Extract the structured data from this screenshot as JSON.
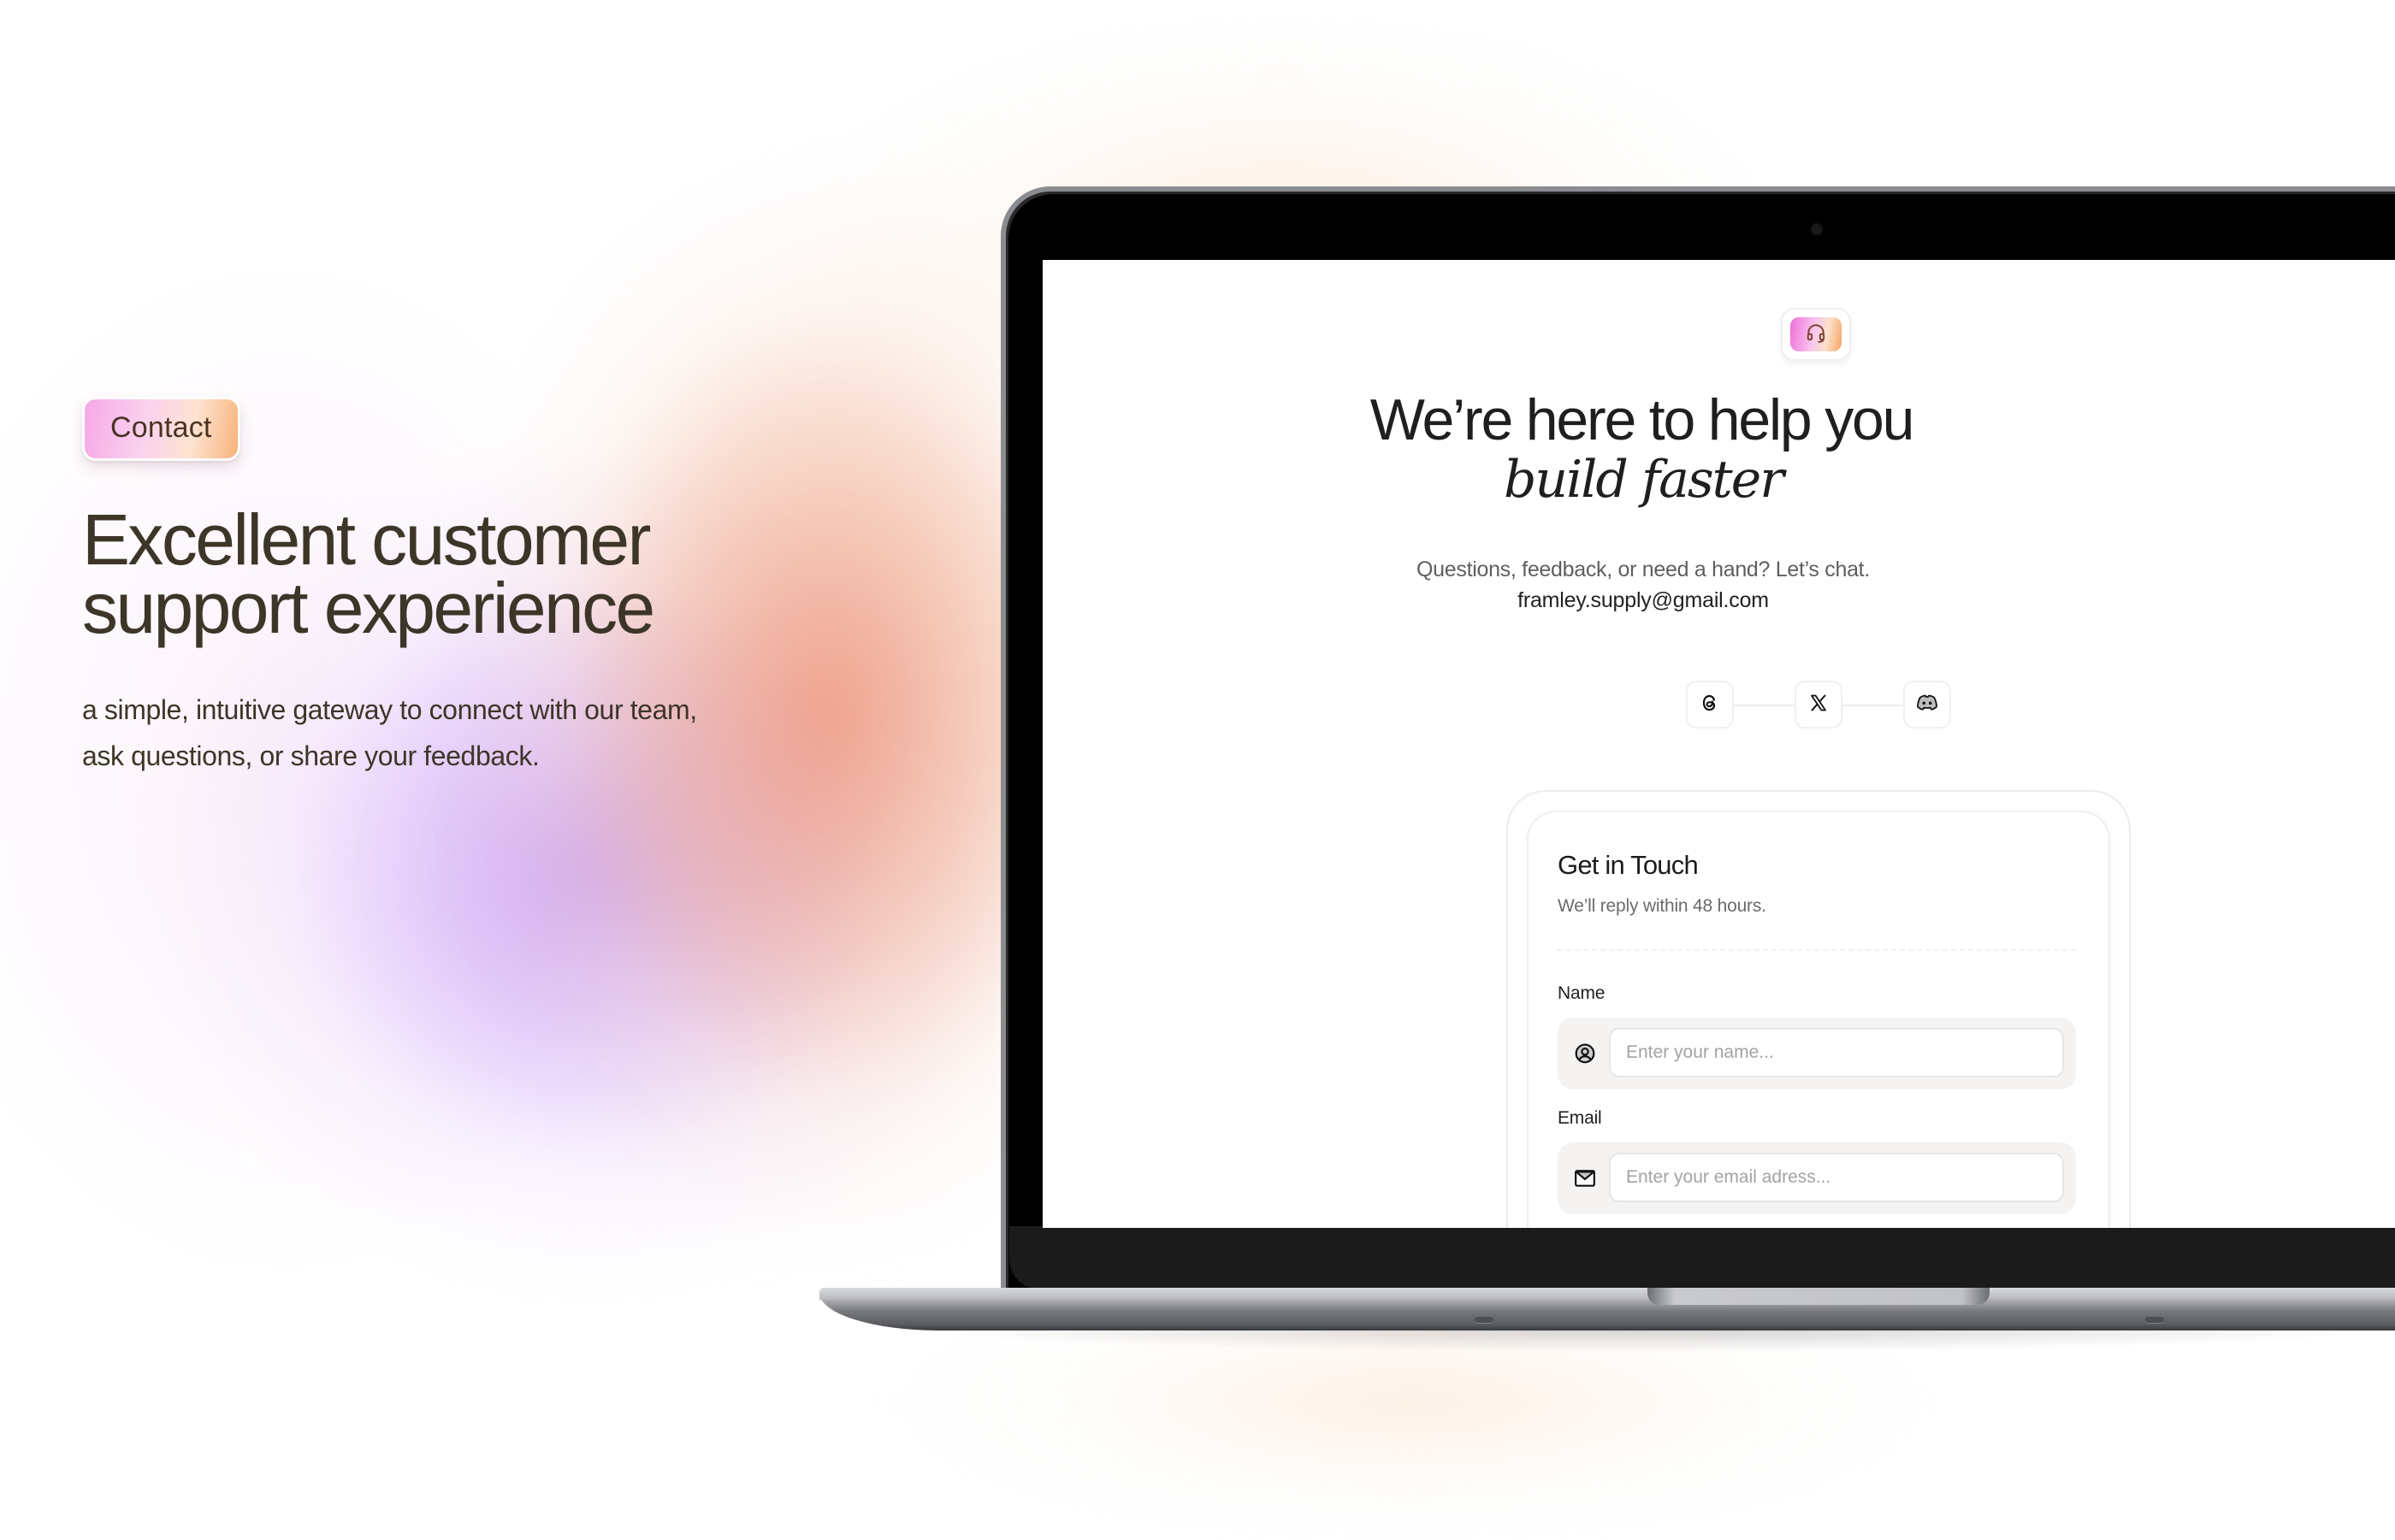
{
  "hero": {
    "badge_label": "Contact",
    "title_line1": "Excellent customer",
    "title_line2": "support experience",
    "subtitle_line1": "a simple, intuitive gateway to connect with our team,",
    "subtitle_line2": "ask questions, or share your feedback."
  },
  "screen": {
    "logo_icon": "headset-icon",
    "headline": "We’re here to help you",
    "headline_italic": "build faster",
    "subheadline": "Questions, feedback, or need a hand? Let’s chat.",
    "contact_email": "framley.supply@gmail.com",
    "socials": [
      {
        "name": "Threads",
        "icon": "threads-icon"
      },
      {
        "name": "X",
        "icon": "x-icon"
      },
      {
        "name": "Discord",
        "icon": "discord-icon"
      }
    ],
    "form": {
      "title": "Get in Touch",
      "subtitle": "We’ll reply within 48 hours.",
      "fields": [
        {
          "label": "Name",
          "icon": "user-circle-icon",
          "placeholder": "Enter your name...",
          "value": ""
        },
        {
          "label": "Email",
          "icon": "mail-icon",
          "placeholder": "Enter your email adress...",
          "value": ""
        }
      ]
    }
  },
  "colors": {
    "hero_text": "#3d3528",
    "badge_gradient_start": "#f6a8e6",
    "badge_gradient_end": "#f8b27a",
    "screen_text": "#1f1f1f",
    "muted_text": "#5f5f5f"
  }
}
